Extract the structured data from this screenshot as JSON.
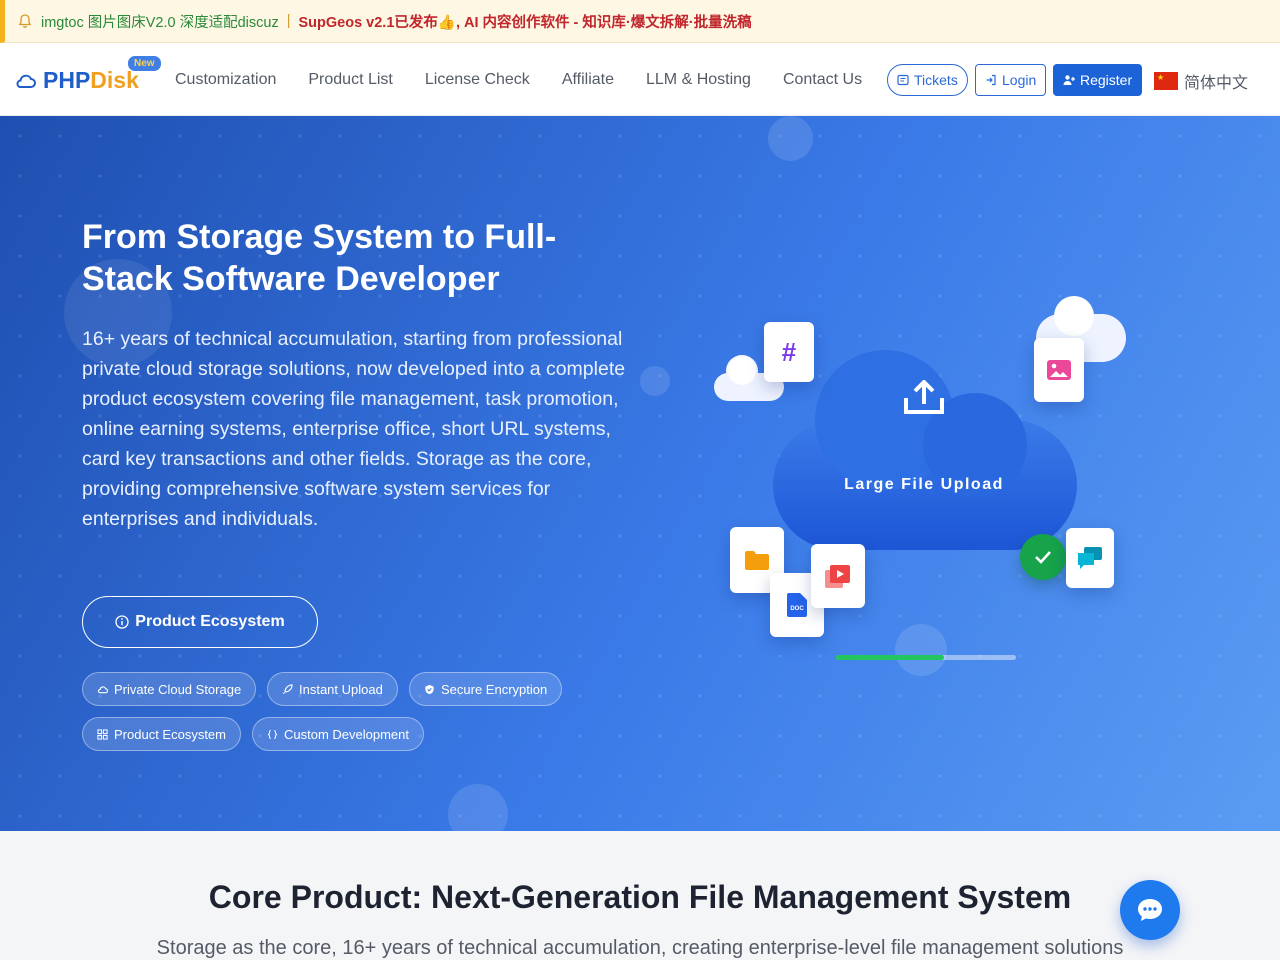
{
  "announcement": {
    "item1": "imgtoc 图片图床V2.0 深度适配discuz",
    "separator": "|",
    "item2": "SupGeos v2.1已发布👍, AI 内容创作软件 - 知识库·爆文拆解·批量洗稿"
  },
  "logo": {
    "part1": "PHP",
    "part2": "Disk",
    "badge": "New"
  },
  "nav": {
    "links": [
      "Customization",
      "Product List",
      "License Check",
      "Affiliate",
      "LLM & Hosting",
      "Contact Us"
    ],
    "tickets": "Tickets",
    "login": "Login",
    "register": "Register",
    "language": "简体中文"
  },
  "hero": {
    "title": "From Storage System to Full-Stack Software Developer",
    "description": "16+ years of technical accumulation, starting from professional private cloud storage solutions, now developed into a complete product ecosystem covering file management, task promotion, online earning systems, enterprise office, short URL systems, card key transactions and other fields. Storage as the core, providing comprehensive software system services for enterprises and individuals.",
    "cta": "Product Ecosystem",
    "tags": [
      "Private Cloud Storage",
      "Instant Upload",
      "Secure Encryption",
      "Product Ecosystem",
      "Custom Development"
    ],
    "illustration": {
      "label": "Large File Upload",
      "progress": 0.6
    }
  },
  "section": {
    "title": "Core Product: Next-Generation File Management System",
    "subtitle": "Storage as the core, 16+ years of technical accumulation, creating enterprise-level file management solutions"
  },
  "colors": {
    "brand": "#1f5ec9",
    "accent": "#f0a020",
    "hero_start": "#1f4fb0",
    "hero_end": "#5b9cf3",
    "success": "#22c55e"
  }
}
